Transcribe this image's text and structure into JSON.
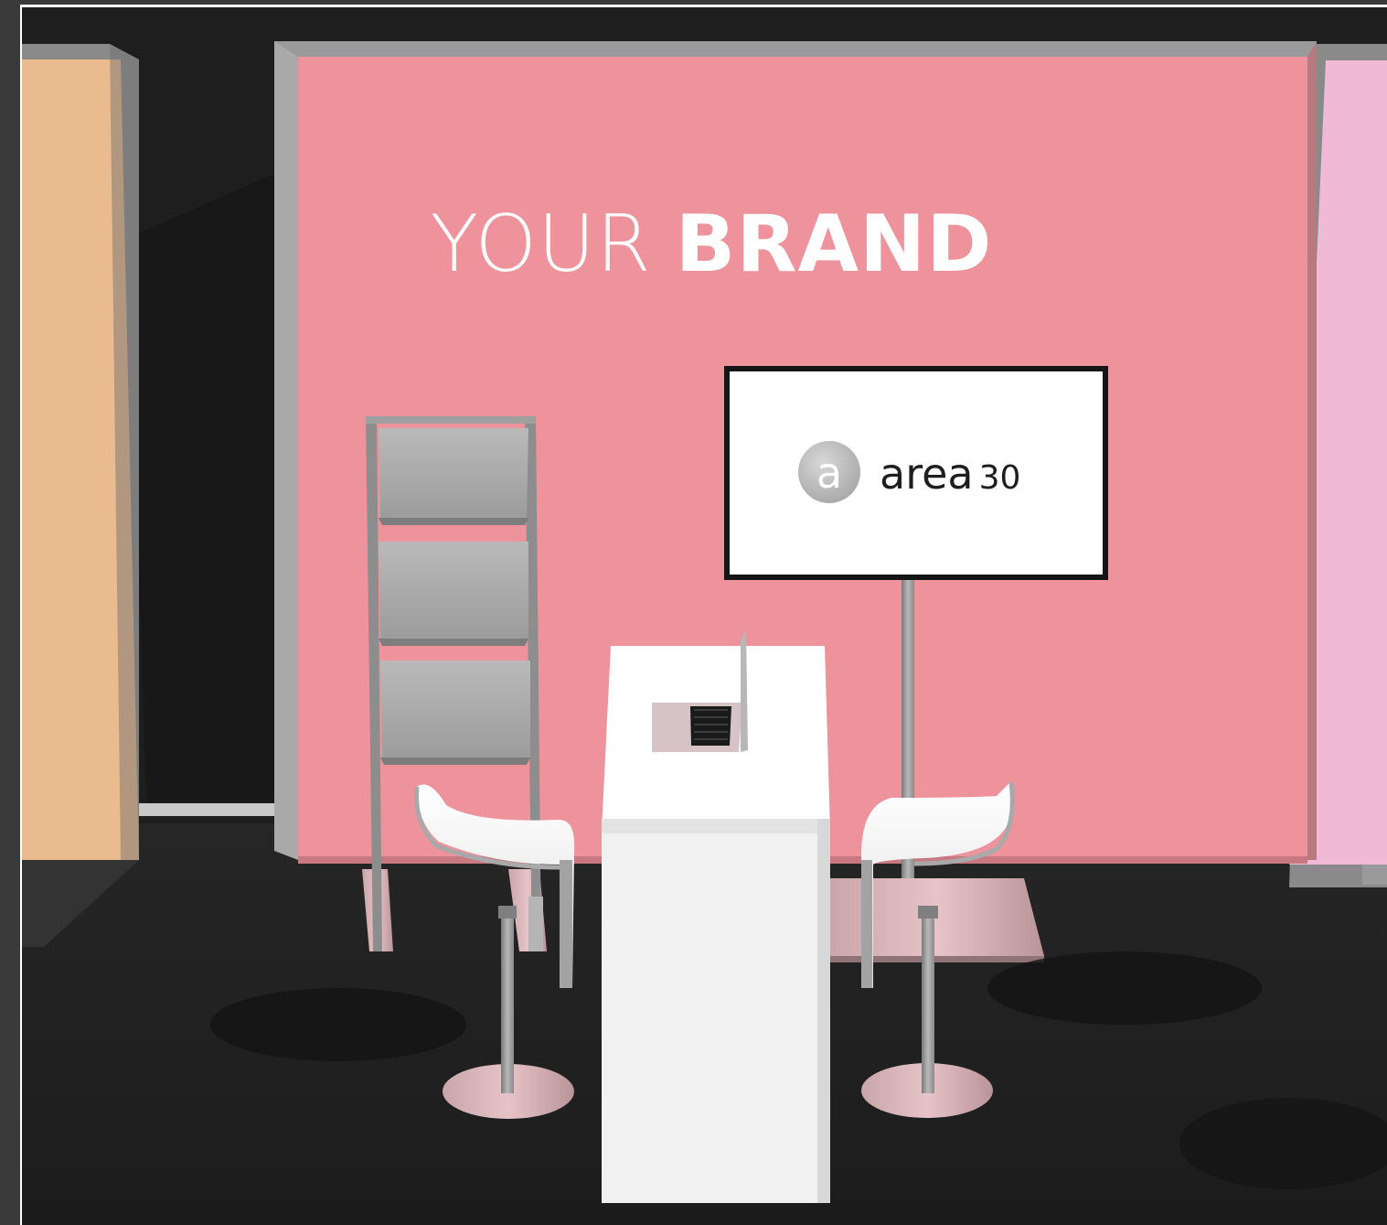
{
  "scene": {
    "description_free": true
  },
  "backwall": {
    "brand_light": "YOUR",
    "brand_bold": "BRAND"
  },
  "monitor": {
    "logo_letter": "a",
    "logo_word": "area",
    "logo_number": "30"
  },
  "colors": {
    "frame": "#3a3a3a",
    "backdrop": "#1e1e1e",
    "floor": "#222222",
    "pink_wall": "#ee929b",
    "peach_wall": "#e9bb8f",
    "lilac_wall": "#f0bad6",
    "counter": "#f4f4f4",
    "metal": "#9a9a9a",
    "screen_bg": "#ffffff"
  }
}
